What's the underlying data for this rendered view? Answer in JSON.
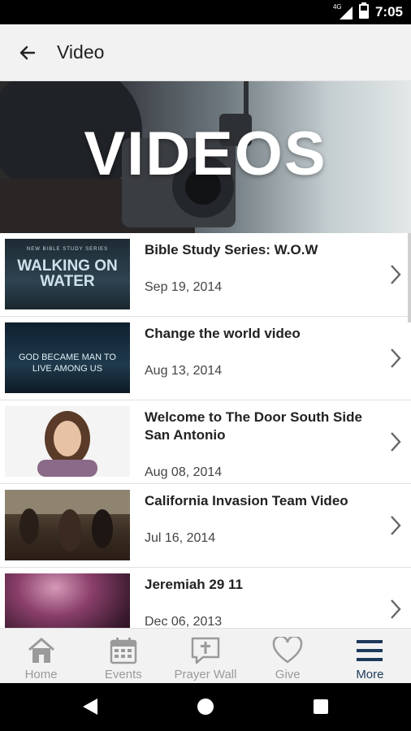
{
  "status_bar": {
    "network": "4G",
    "time": "7:05"
  },
  "app_bar": {
    "title": "Video"
  },
  "hero": {
    "title": "VIDEOS"
  },
  "videos": [
    {
      "title": "Bible Study Series: W.O.W",
      "date": "Sep 19, 2014",
      "thumb_caption": "WALKING ON WATER",
      "thumb_sub": "NEW BIBLE STUDY SERIES"
    },
    {
      "title": "Change the world video",
      "date": "Aug 13, 2014",
      "thumb_caption": "GOD BECAME MAN TO LIVE AMONG US"
    },
    {
      "title": "Welcome to The Door South Side San Antonio",
      "date": "Aug 08, 2014"
    },
    {
      "title": "California Invasion Team Video",
      "date": "Jul 16, 2014"
    },
    {
      "title": "Jeremiah 29 11",
      "date": "Dec 06, 2013"
    }
  ],
  "bottom_nav": [
    {
      "label": "Home",
      "icon": "home-icon",
      "active": false
    },
    {
      "label": "Events",
      "icon": "calendar-icon",
      "active": false
    },
    {
      "label": "Prayer Wall",
      "icon": "prayer-wall-icon",
      "active": false
    },
    {
      "label": "Give",
      "icon": "heart-icon",
      "active": false
    },
    {
      "label": "More",
      "icon": "menu-icon",
      "active": true
    }
  ],
  "colors": {
    "active_nav": "#1d3a5a",
    "inactive_nav": "#9a9a9a",
    "app_bar_bg": "#f2f2f2"
  }
}
